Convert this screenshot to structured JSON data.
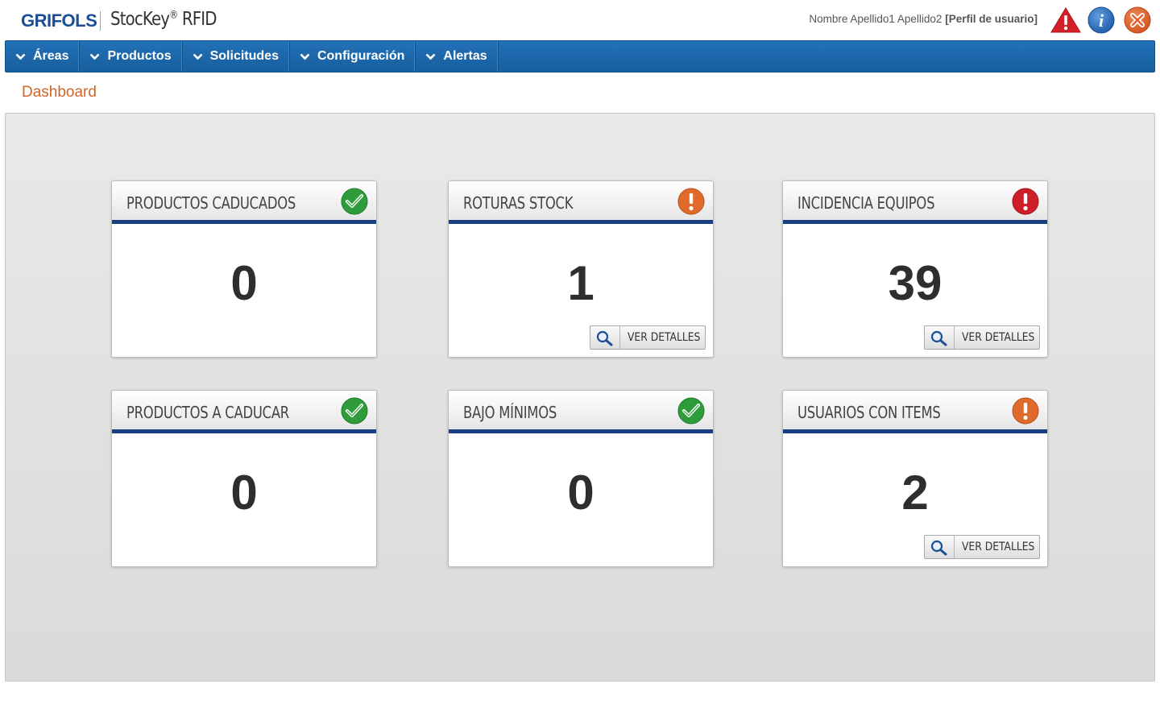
{
  "header": {
    "brand": "GRIFOLS",
    "app_name": "StocKey",
    "app_mark": "®",
    "app_suffix": " RFID",
    "user_name": "Nombre Apellido1 Apellido2",
    "user_profile": "[Perfil de usuario]",
    "icons": [
      "warning-icon",
      "info-icon",
      "close-icon"
    ]
  },
  "nav": {
    "items": [
      {
        "label": "Áreas"
      },
      {
        "label": "Productos"
      },
      {
        "label": "Solicitudes"
      },
      {
        "label": "Configuración"
      },
      {
        "label": "Alertas"
      }
    ]
  },
  "breadcrumb": "Dashboard",
  "colors": {
    "brand_blue": "#1a4e96",
    "nav_blue": "#1f6aae",
    "accent_orange": "#d2642a",
    "status_ok": "#2e9c3a",
    "status_warning": "#e06a2b",
    "status_error": "#cc1f2a"
  },
  "cards": [
    {
      "title": "PRODUCTOS CADUCADOS",
      "value": "0",
      "status": "ok",
      "status_icon": "check-icon"
    },
    {
      "title": "ROTURAS STOCK",
      "value": "1",
      "status": "warning",
      "status_icon": "exclamation-icon",
      "button": "VER DETALLES"
    },
    {
      "title": "INCIDENCIA EQUIPOS",
      "value": "39",
      "status": "error",
      "status_icon": "exclamation-icon",
      "button": "VER DETALLES"
    },
    {
      "title": "PRODUCTOS A CADUCAR",
      "value": "0",
      "status": "ok",
      "status_icon": "check-icon"
    },
    {
      "title": "BAJO MÍNIMOS",
      "value": "0",
      "status": "ok",
      "status_icon": "check-icon"
    },
    {
      "title": "USUARIOS CON ITEMS",
      "value": "2",
      "status": "warning",
      "status_icon": "exclamation-icon",
      "button": "VER DETALLES"
    }
  ]
}
